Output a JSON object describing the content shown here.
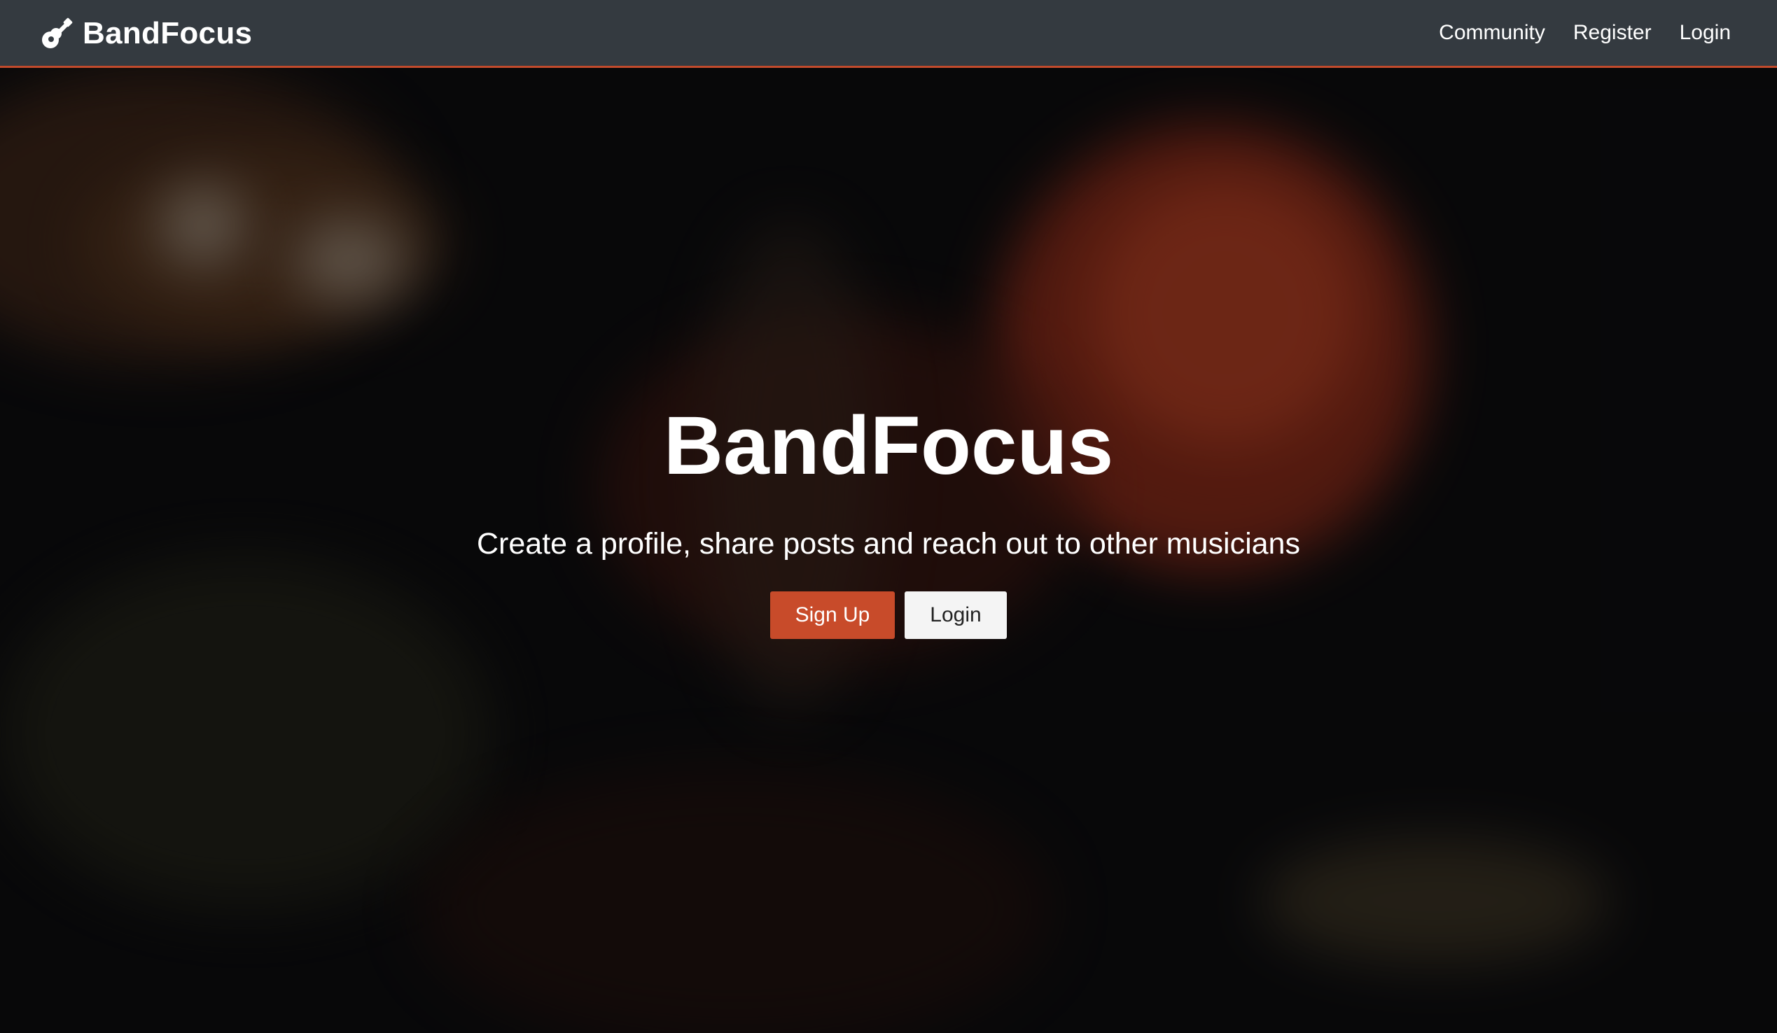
{
  "navbar": {
    "brand_icon": "guitar-icon",
    "brand_name": "BandFocus",
    "links": [
      "Community",
      "Register",
      "Login"
    ]
  },
  "hero": {
    "title": "BandFocus",
    "subtitle": "Create a profile, share posts and reach out to other musicians",
    "signup_label": "Sign Up",
    "login_label": "Login"
  },
  "colors": {
    "navbar_bg": "#343a40",
    "accent": "#c84b2a",
    "light_button": "#f4f4f4",
    "text": "#ffffff"
  }
}
